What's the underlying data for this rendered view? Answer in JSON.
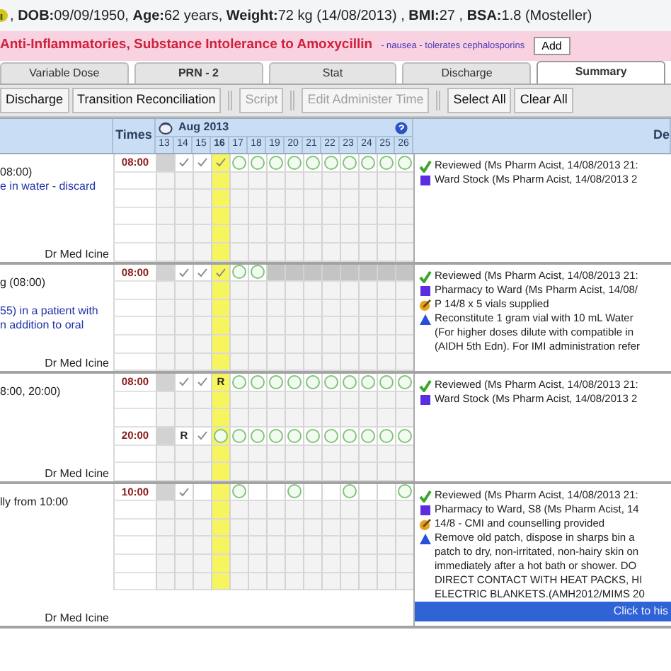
{
  "patient_header": {
    "text": ", **DOB:**09/09/1950, **Age:**62 years, **Weight:**72 kg (14/08/2013) , **BMI:**27 , **BSA:**1.8 (Mosteller)"
  },
  "allergies": {
    "text": "Anti-Inflammatories, Substance Intolerance to Amoxycillin",
    "reaction": "- nausea - tolerates cephalosporins",
    "add_button": "Add"
  },
  "tabs": [
    {
      "label": "Variable Dose",
      "emphasized": false,
      "selected": false
    },
    {
      "label": "PRN - 2",
      "emphasized": true,
      "selected": false
    },
    {
      "label": "Stat",
      "emphasized": false,
      "selected": false
    },
    {
      "label": "Discharge",
      "emphasized": false,
      "selected": false
    },
    {
      "label": "Summary",
      "emphasized": true,
      "selected": true
    }
  ],
  "toolbar": [
    {
      "kind": "button",
      "label": "Discharge",
      "disabled": false
    },
    {
      "kind": "button",
      "label": "Transition Reconciliation",
      "disabled": false
    },
    {
      "kind": "separator"
    },
    {
      "kind": "button",
      "label": "Script",
      "disabled": true
    },
    {
      "kind": "separator"
    },
    {
      "kind": "button",
      "label": "Edit Administer Time",
      "disabled": true
    },
    {
      "kind": "separator"
    },
    {
      "kind": "button",
      "label": "Select All",
      "disabled": false
    },
    {
      "kind": "button",
      "label": "Clear All",
      "disabled": false
    }
  ],
  "grid": {
    "times_header": "Times",
    "month": "Aug 2013",
    "details_header": "De",
    "days": [
      {
        "day": "13",
        "selected": false
      },
      {
        "day": "14",
        "selected": false
      },
      {
        "day": "15",
        "selected": false
      },
      {
        "day": "16",
        "selected": true
      },
      {
        "day": "17",
        "selected": false
      },
      {
        "day": "18",
        "selected": false
      },
      {
        "day": "19",
        "selected": false
      },
      {
        "day": "20",
        "selected": false
      },
      {
        "day": "21",
        "selected": false
      },
      {
        "day": "22",
        "selected": false
      },
      {
        "day": "23",
        "selected": false
      },
      {
        "day": "24",
        "selected": false
      },
      {
        "day": "25",
        "selected": false
      },
      {
        "day": "26",
        "selected": false
      }
    ],
    "blocks": [
      {
        "dose_text": "08:00)",
        "notes": [
          "e in water - discard"
        ],
        "prescriber": "Dr Med Icine",
        "times": [
          {
            "time": "08:00",
            "cells": [
              {
                "kind": "na"
              },
              {
                "kind": "given"
              },
              {
                "kind": "given"
              },
              {
                "kind": "given"
              },
              {
                "kind": "due"
              },
              {
                "kind": "due"
              },
              {
                "kind": "due"
              },
              {
                "kind": "due"
              },
              {
                "kind": "due"
              },
              {
                "kind": "due"
              },
              {
                "kind": "due"
              },
              {
                "kind": "due"
              },
              {
                "kind": "due"
              },
              {
                "kind": "due"
              }
            ]
          }
        ],
        "details": [
          {
            "kind": "reviewed",
            "lines": [
              "Reviewed (Ms Pharm Acist, 14/08/2013 21:"
            ]
          },
          {
            "kind": "supply",
            "lines": [
              "Ward Stock (Ms Pharm Acist, 14/08/2013 2"
            ]
          }
        ]
      },
      {
        "dose_text": "g (08:00)",
        "notes": [
          "55) in a patient with",
          "n addition to oral"
        ],
        "prescriber": "Dr Med Icine",
        "times": [
          {
            "time": "08:00",
            "cells": [
              {
                "kind": "na"
              },
              {
                "kind": "given"
              },
              {
                "kind": "given"
              },
              {
                "kind": "given"
              },
              {
                "kind": "due"
              },
              {
                "kind": "due"
              },
              {
                "kind": "blocked"
              },
              {
                "kind": "blocked"
              },
              {
                "kind": "blocked"
              },
              {
                "kind": "blocked"
              },
              {
                "kind": "blocked"
              },
              {
                "kind": "blocked"
              },
              {
                "kind": "blocked"
              },
              {
                "kind": "blocked"
              }
            ]
          }
        ],
        "details": [
          {
            "kind": "reviewed",
            "lines": [
              "Reviewed (Ms Pharm Acist, 14/08/2013 21:"
            ]
          },
          {
            "kind": "supply",
            "lines": [
              "Pharmacy to Ward (Ms Pharm Acist, 14/08/"
            ]
          },
          {
            "kind": "counselling",
            "lines": [
              "P 14/8 x 5 vials supplied"
            ]
          },
          {
            "kind": "instruction",
            "lines": [
              "Reconstitute 1 gram vial with 10 mL Water",
              "(For higher doses dilute with compatible in",
              "(AIDH 5th Edn). For IMI administration refer"
            ]
          }
        ]
      },
      {
        "dose_text": "8:00, 20:00)",
        "prescriber": "Dr Med Icine",
        "times": [
          {
            "time": "08:00",
            "cells": [
              {
                "kind": "na"
              },
              {
                "kind": "given"
              },
              {
                "kind": "given"
              },
              {
                "kind": "code",
                "text": "R"
              },
              {
                "kind": "due"
              },
              {
                "kind": "due"
              },
              {
                "kind": "due"
              },
              {
                "kind": "due"
              },
              {
                "kind": "due"
              },
              {
                "kind": "due"
              },
              {
                "kind": "due"
              },
              {
                "kind": "due"
              },
              {
                "kind": "due"
              },
              {
                "kind": "due"
              }
            ]
          },
          {
            "time": "20:00",
            "cells": [
              {
                "kind": "na"
              },
              {
                "kind": "code",
                "text": "R"
              },
              {
                "kind": "given"
              },
              {
                "kind": "due"
              },
              {
                "kind": "due"
              },
              {
                "kind": "due"
              },
              {
                "kind": "due"
              },
              {
                "kind": "due"
              },
              {
                "kind": "due"
              },
              {
                "kind": "due"
              },
              {
                "kind": "due"
              },
              {
                "kind": "due"
              },
              {
                "kind": "due"
              },
              {
                "kind": "due"
              }
            ]
          }
        ],
        "details": [
          {
            "kind": "reviewed",
            "lines": [
              "Reviewed (Ms Pharm Acist, 14/08/2013 21:"
            ]
          },
          {
            "kind": "supply",
            "lines": [
              "Ward Stock (Ms Pharm Acist, 14/08/2013 2"
            ]
          }
        ]
      },
      {
        "dose_text": "lly from 10:00",
        "prescriber": "Dr Med Icine",
        "times": [
          {
            "time": "10:00",
            "cells": [
              {
                "kind": "na"
              },
              {
                "kind": "given"
              },
              {
                "kind": "none"
              },
              {
                "kind": "none"
              },
              {
                "kind": "due"
              },
              {
                "kind": "none"
              },
              {
                "kind": "none"
              },
              {
                "kind": "due"
              },
              {
                "kind": "none"
              },
              {
                "kind": "none"
              },
              {
                "kind": "due"
              },
              {
                "kind": "none"
              },
              {
                "kind": "none"
              },
              {
                "kind": "due"
              }
            ]
          }
        ],
        "details": [
          {
            "kind": "reviewed",
            "lines": [
              "Reviewed (Ms Pharm Acist, 14/08/2013 21:"
            ]
          },
          {
            "kind": "supply",
            "lines": [
              "Pharmacy to Ward, S8 (Ms Pharm Acist, 14"
            ]
          },
          {
            "kind": "counselling",
            "lines": [
              "14/8 - CMI and counselling provided"
            ]
          },
          {
            "kind": "instruction",
            "lines": [
              "Remove old patch, dispose in sharps bin a",
              "patch to dry, non-irritated, non-hairy skin on",
              "immediately after a hot bath or shower. DO",
              "DIRECT CONTACT WITH HEAT PACKS, HI",
              "ELECTRIC BLANKETS.(AMH2012/MIMS 20"
            ]
          }
        ],
        "history_button": "Click to his"
      }
    ]
  }
}
